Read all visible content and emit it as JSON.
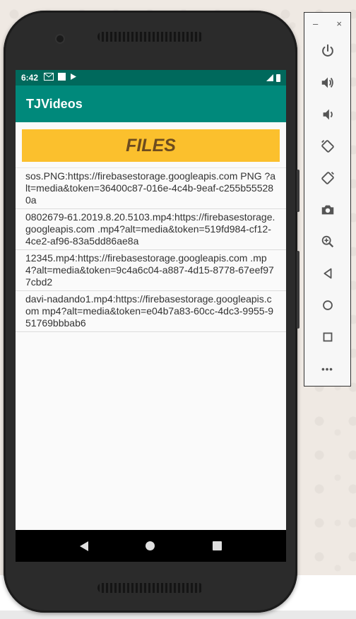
{
  "status_bar": {
    "time": "6:42"
  },
  "app": {
    "title": "TJVideos",
    "banner": "FILES"
  },
  "files": [
    {
      "text": "sos.PNG:https://firebasestorage.googleapis.com PNG ?alt=media&token=36400c87-016e-4c4b-9eaf-c255b555280a"
    },
    {
      "text": "0802679-61.2019.8.20.5103.mp4:https://firebasestorage.googleapis.com .mp4?alt=media&token=519fd984-cf12-4ce2-af96-83a5dd86ae8a"
    },
    {
      "text": "12345.mp4:https://firebasestorage.googleapis.com .mp4?alt=media&token=9c4a6c04-a887-4d15-8778-67eef977cbd2"
    },
    {
      "text": "davi-nadando1.mp4:https://firebasestorage.googleapis.com mp4?alt=media&token=e04b7a83-60cc-4dc3-9955-951769bbbab6"
    }
  ],
  "emulator_toolbar": {
    "minimize": "–",
    "close": "×",
    "more": "•••"
  },
  "colors": {
    "status_bar": "#00695c",
    "app_bar": "#00897b",
    "banner": "#fbc02d",
    "banner_text": "#6d4c1f"
  }
}
